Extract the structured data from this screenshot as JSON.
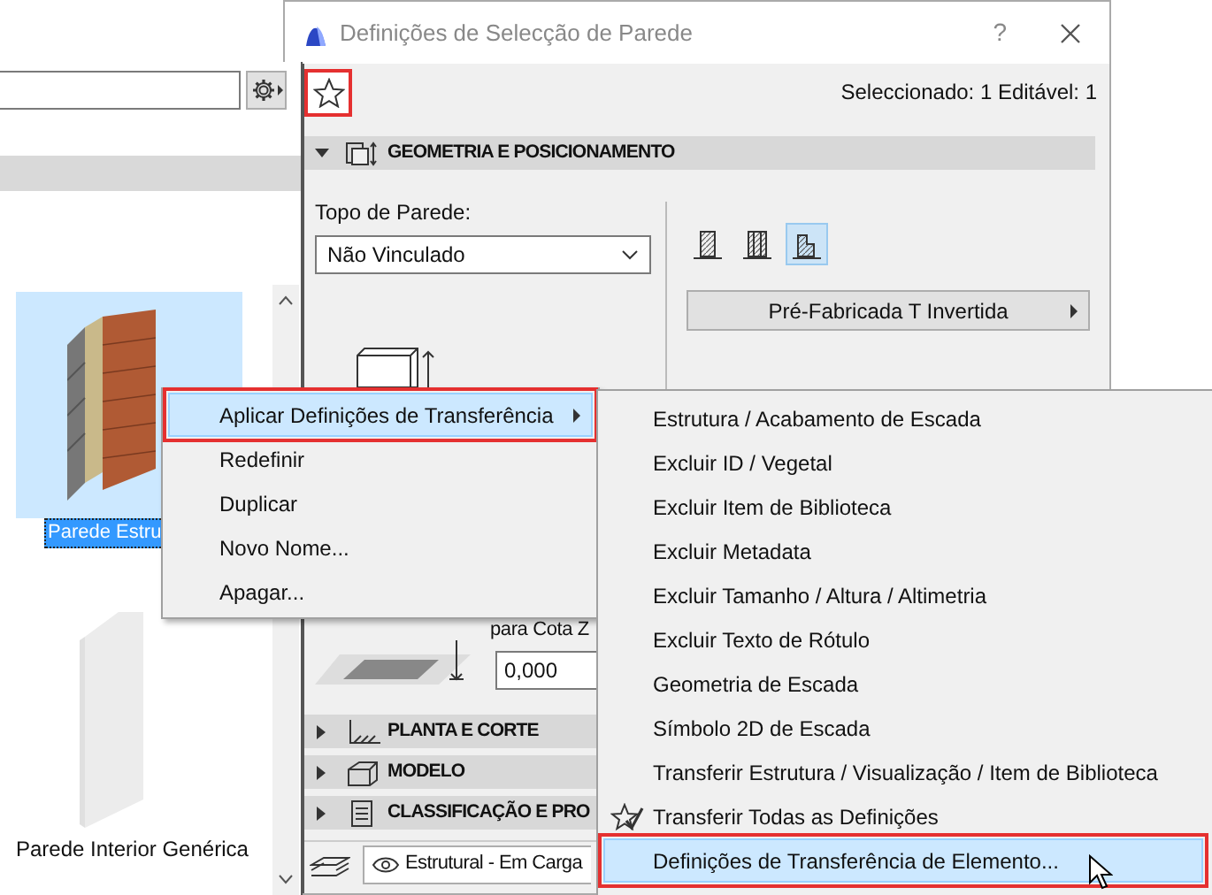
{
  "library": {
    "items": [
      {
        "label": "Parede Estru",
        "selected": true
      },
      {
        "label": "Parede Interior Genérica",
        "selected": false
      }
    ]
  },
  "dialog": {
    "title": "Definições de Selecção de Parede",
    "help": "?",
    "favorites_button": {
      "annotated": true
    },
    "selection_info": "Seleccionado: 1 Editável: 1",
    "sections": [
      {
        "title": "GEOMETRIA E POSICIONAMENTO",
        "expanded": true
      },
      {
        "title": "PLANTA E CORTE",
        "expanded": false
      },
      {
        "title": "MODELO",
        "expanded": false
      },
      {
        "title": "CLASSIFICAÇÃO E PRO",
        "expanded": false
      }
    ],
    "wall_top": {
      "label": "Topo de Parede:",
      "value": "Não Vinculado"
    },
    "profile_options": [
      {
        "selected": false
      },
      {
        "selected": false
      },
      {
        "selected": true
      }
    ],
    "profile_button": "Pré-Fabricada T Invertida",
    "z_offset": {
      "label": "para Cota Z",
      "value": "0,000"
    },
    "layer": "Estrutural - Em Carga"
  },
  "context_menu": {
    "items": [
      {
        "label": "Aplicar Definições de Transferência",
        "selected": true,
        "annotated": true,
        "has_submenu": true
      },
      {
        "label": "Redefinir",
        "selected": false,
        "annotated": false,
        "has_submenu": false
      },
      {
        "label": "Duplicar",
        "selected": false,
        "annotated": false,
        "has_submenu": false
      },
      {
        "label": "Novo Nome...",
        "selected": false,
        "annotated": false,
        "has_submenu": false
      },
      {
        "label": "Apagar...",
        "selected": false,
        "annotated": false,
        "has_submenu": false
      }
    ]
  },
  "submenu": {
    "items": [
      {
        "label": "Estrutura / Acabamento de Escada",
        "kind": "plain",
        "selected": false,
        "annotated": false
      },
      {
        "label": "Excluir ID / Vegetal",
        "kind": "plain",
        "selected": false,
        "annotated": false
      },
      {
        "label": "Excluir Item de Biblioteca",
        "kind": "plain",
        "selected": false,
        "annotated": false
      },
      {
        "label": "Excluir Metadata",
        "kind": "plain",
        "selected": false,
        "annotated": false
      },
      {
        "label": "Excluir Tamanho / Altura / Altimetria",
        "kind": "plain",
        "selected": false,
        "annotated": false
      },
      {
        "label": "Excluir Texto de Rótulo",
        "kind": "plain",
        "selected": false,
        "annotated": false
      },
      {
        "label": "Geometria de Escada",
        "kind": "plain",
        "selected": false,
        "annotated": false
      },
      {
        "label": "Símbolo 2D de Escada",
        "kind": "plain",
        "selected": false,
        "annotated": false
      },
      {
        "label": "Transferir Estrutura / Visualização / Item de Biblioteca",
        "kind": "plain",
        "selected": false,
        "annotated": false
      },
      {
        "label": "Transferir Todas as Definições",
        "kind": "favorite",
        "selected": false,
        "annotated": false
      },
      {
        "label": "Definições de Transferência de Elemento...",
        "kind": "plain",
        "selected": true,
        "annotated": true
      }
    ]
  }
}
